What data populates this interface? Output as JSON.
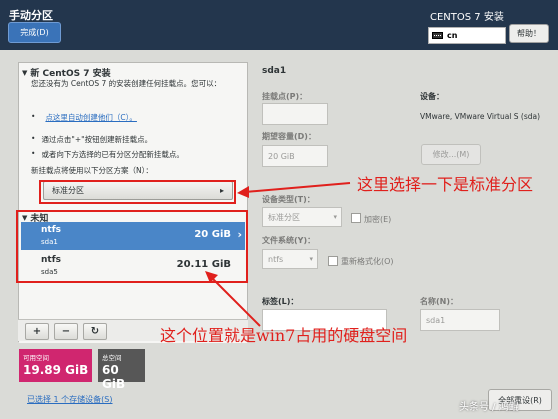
{
  "header": {
    "page_title": "手动分区",
    "done_label": "完成(D)",
    "product_title": "CENTOS 7 安装",
    "keyboard": "cn",
    "help_label": "帮助！"
  },
  "left": {
    "new_install_title": "新 CentOS 7 安装",
    "intro_text": "您还没有为 CentOS 7 的安装创建任何挂载点。您可以：",
    "auto_create_link": "点这里自动创建他们（C）。",
    "bullet_add": "通过点击\"+\"按钮创建新挂载点。",
    "bullet_assign": "或者向下方选择的已有分区分配新挂载点。",
    "scheme_hint": "新挂载点将使用以下分区方案（N）：",
    "scheme_value": "标准分区",
    "unknown_title": "未知",
    "partitions": [
      {
        "name": "ntfs",
        "device": "sda1",
        "size": "20 GiB"
      },
      {
        "name": "ntfs",
        "device": "sda5",
        "size": "20.11 GiB"
      }
    ],
    "toolbar": {
      "add": "+",
      "remove": "−",
      "refresh": "↻"
    },
    "available_label": "可用空间",
    "available_value": "19.89 GiB",
    "total_label": "总空间",
    "total_value": "60 GiB",
    "storage_link": "已选择 1 个存储设备(S)"
  },
  "right": {
    "title": "sda1",
    "mount_label": "挂载点(P)：",
    "capacity_label": "期望容量(D)：",
    "capacity_value": "20 GiB",
    "device_label": "设备：",
    "device_value": "VMware, VMware Virtual S (sda)",
    "modify_label": "修改...(M)",
    "device_type_label": "设备类型(T)：",
    "device_type_value": "标准分区",
    "encrypt_label": "加密(E)",
    "fs_label": "文件系统(Y)：",
    "fs_value": "ntfs",
    "reformat_label": "重新格式化(O)",
    "tag_label": "标签(L)：",
    "name_label": "名称(N)：",
    "name_value": "sda1",
    "reset_label": "全部重设(R)"
  },
  "annotations": {
    "scheme_note": "这里选择一下是标准分区",
    "space_note": "这个位置就是win7占用的硬盘空间"
  },
  "watermark": "头条号 / 鸿鲲"
}
